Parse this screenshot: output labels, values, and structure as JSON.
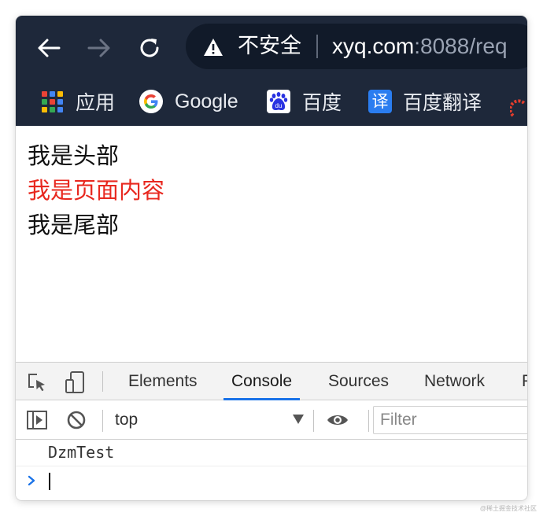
{
  "browser": {
    "security_label": "不安全",
    "url_host": "xyq.com",
    "url_rest": ":8088/req",
    "bookmarks": [
      {
        "label": "应用",
        "icon": "apps-grid-icon"
      },
      {
        "label": "Google",
        "icon": "google-icon"
      },
      {
        "label": "百度",
        "icon": "baidu-icon"
      },
      {
        "label": "百度翻译",
        "icon": "fanyi-icon",
        "icon_glyph": "译"
      }
    ],
    "colors": {
      "chrome": "#1e283a",
      "omnibox": "#111a29",
      "fanyi_blue": "#2a7df0",
      "baidu_blue": "#2932e1"
    }
  },
  "page": {
    "lines": [
      "我是头部",
      "我是页面内容",
      "我是尾部"
    ],
    "colors": {
      "body_text": "#e8281f"
    }
  },
  "devtools": {
    "tabs": [
      "Elements",
      "Console",
      "Sources",
      "Network",
      "P"
    ],
    "active_tab": "Console",
    "context": "top",
    "filter_placeholder": "Filter",
    "logs": [
      "DzmTest"
    ],
    "accent": "#1a73e8"
  },
  "watermark": "@稀土掘金技术社区"
}
